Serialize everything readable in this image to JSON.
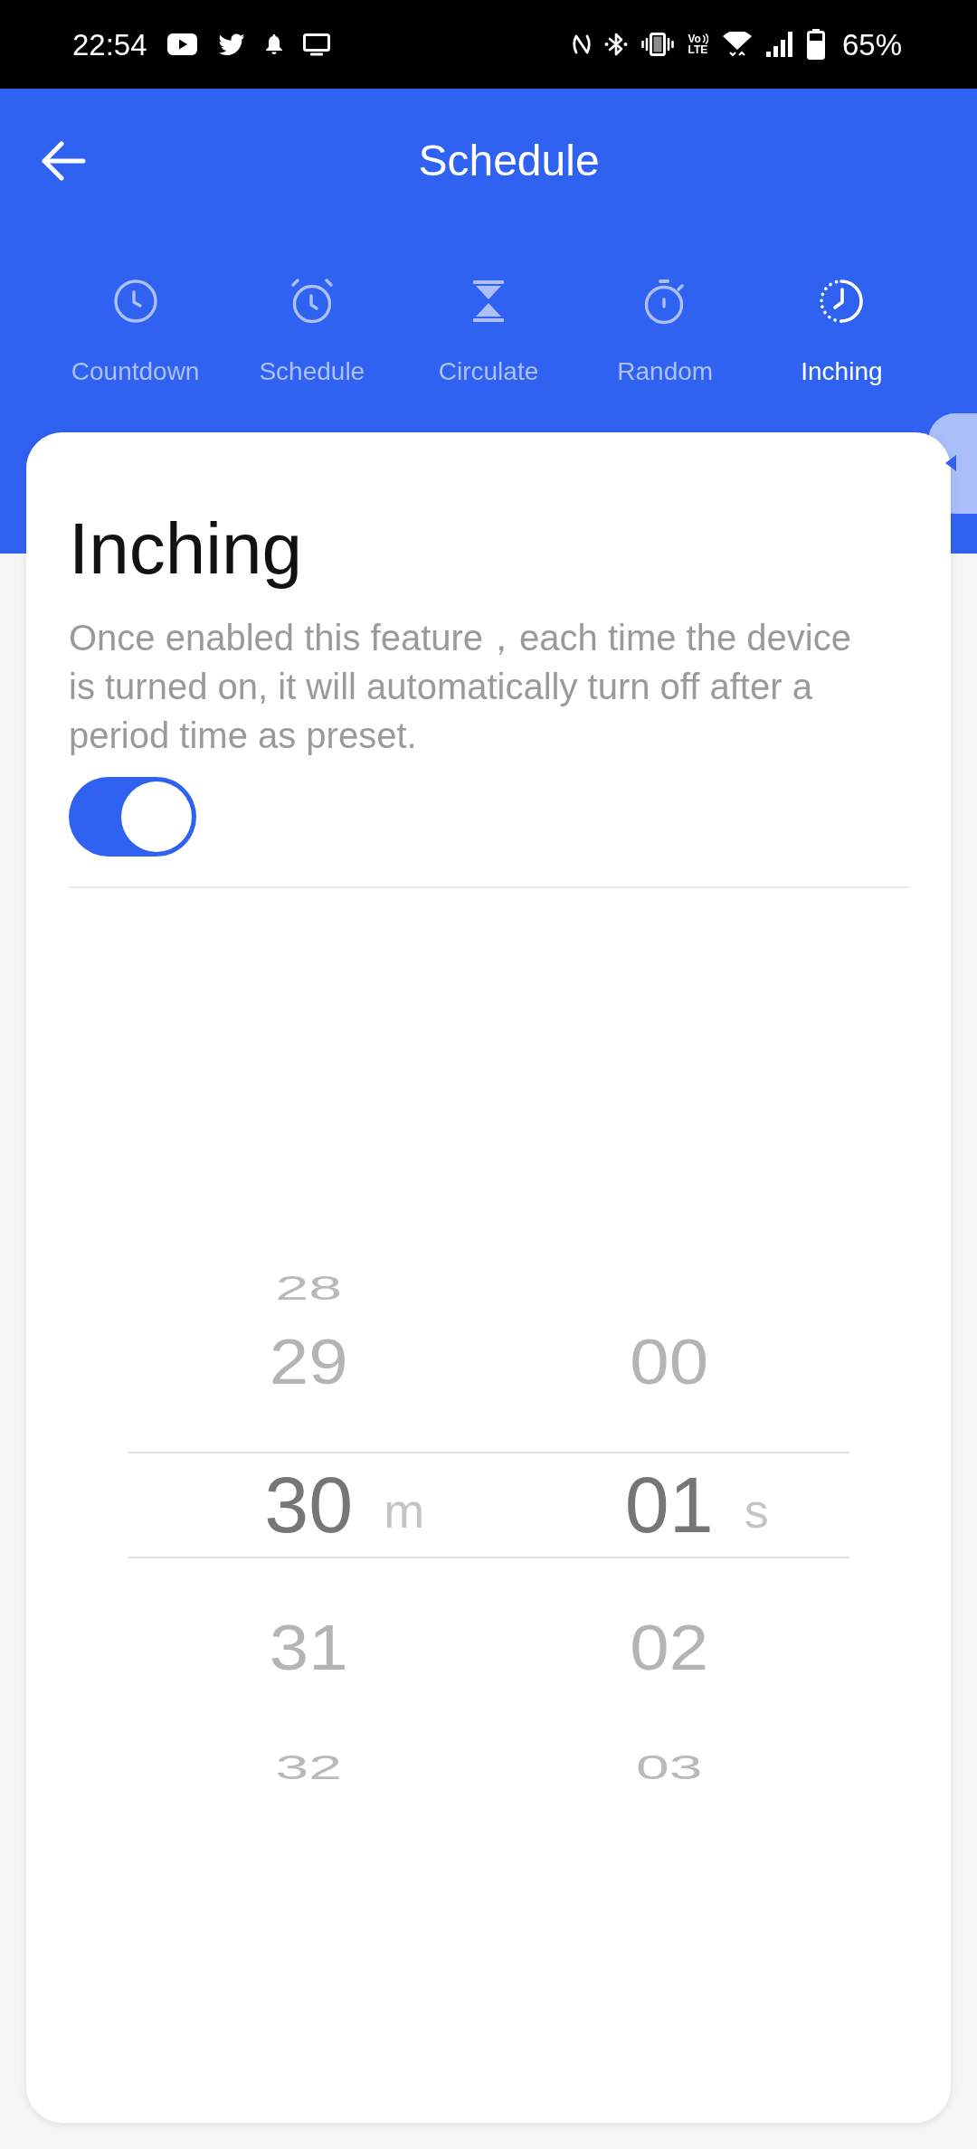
{
  "status_bar": {
    "time": "22:54",
    "volte": [
      "Vo",
      "LTE"
    ],
    "battery_text": "65%"
  },
  "header": {
    "title": "Schedule"
  },
  "tabs": [
    {
      "label": "Countdown",
      "selected": false
    },
    {
      "label": "Schedule",
      "selected": false
    },
    {
      "label": "Circulate",
      "selected": false
    },
    {
      "label": "Random",
      "selected": false
    },
    {
      "label": "Inching",
      "selected": true
    }
  ],
  "panel": {
    "title": "Inching",
    "description": "Once enabled this feature，each time the device is turned on, it will automatically turn off after a period time as preset.",
    "enabled": true
  },
  "picker": {
    "columns": [
      {
        "unit": "m",
        "items": [
          {
            "value": "28",
            "selected": false
          },
          {
            "value": "29",
            "selected": false
          },
          {
            "value": "30",
            "selected": true
          },
          {
            "value": "31",
            "selected": false
          },
          {
            "value": "32",
            "selected": false
          }
        ]
      },
      {
        "unit": "s",
        "items": [
          {
            "value": "00",
            "selected": false
          },
          {
            "value": "01",
            "selected": true
          },
          {
            "value": "02",
            "selected": false
          },
          {
            "value": "03",
            "selected": false
          }
        ]
      }
    ]
  }
}
